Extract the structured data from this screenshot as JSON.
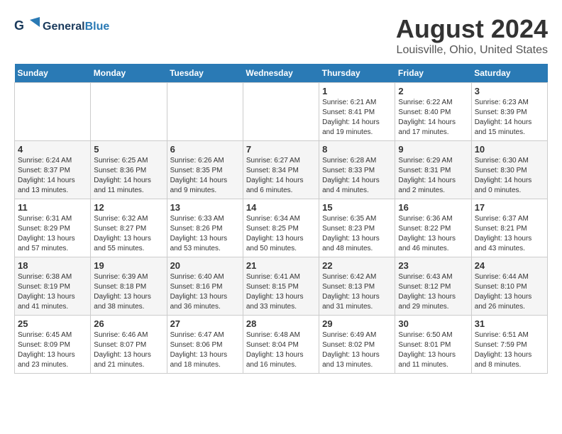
{
  "header": {
    "logo_general": "General",
    "logo_blue": "Blue",
    "month_title": "August 2024",
    "location": "Louisville, Ohio, United States"
  },
  "days_of_week": [
    "Sunday",
    "Monday",
    "Tuesday",
    "Wednesday",
    "Thursday",
    "Friday",
    "Saturday"
  ],
  "weeks": [
    [
      {
        "day": "",
        "info": ""
      },
      {
        "day": "",
        "info": ""
      },
      {
        "day": "",
        "info": ""
      },
      {
        "day": "",
        "info": ""
      },
      {
        "day": "1",
        "info": "Sunrise: 6:21 AM\nSunset: 8:41 PM\nDaylight: 14 hours\nand 19 minutes."
      },
      {
        "day": "2",
        "info": "Sunrise: 6:22 AM\nSunset: 8:40 PM\nDaylight: 14 hours\nand 17 minutes."
      },
      {
        "day": "3",
        "info": "Sunrise: 6:23 AM\nSunset: 8:39 PM\nDaylight: 14 hours\nand 15 minutes."
      }
    ],
    [
      {
        "day": "4",
        "info": "Sunrise: 6:24 AM\nSunset: 8:37 PM\nDaylight: 14 hours\nand 13 minutes."
      },
      {
        "day": "5",
        "info": "Sunrise: 6:25 AM\nSunset: 8:36 PM\nDaylight: 14 hours\nand 11 minutes."
      },
      {
        "day": "6",
        "info": "Sunrise: 6:26 AM\nSunset: 8:35 PM\nDaylight: 14 hours\nand 9 minutes."
      },
      {
        "day": "7",
        "info": "Sunrise: 6:27 AM\nSunset: 8:34 PM\nDaylight: 14 hours\nand 6 minutes."
      },
      {
        "day": "8",
        "info": "Sunrise: 6:28 AM\nSunset: 8:33 PM\nDaylight: 14 hours\nand 4 minutes."
      },
      {
        "day": "9",
        "info": "Sunrise: 6:29 AM\nSunset: 8:31 PM\nDaylight: 14 hours\nand 2 minutes."
      },
      {
        "day": "10",
        "info": "Sunrise: 6:30 AM\nSunset: 8:30 PM\nDaylight: 14 hours\nand 0 minutes."
      }
    ],
    [
      {
        "day": "11",
        "info": "Sunrise: 6:31 AM\nSunset: 8:29 PM\nDaylight: 13 hours\nand 57 minutes."
      },
      {
        "day": "12",
        "info": "Sunrise: 6:32 AM\nSunset: 8:27 PM\nDaylight: 13 hours\nand 55 minutes."
      },
      {
        "day": "13",
        "info": "Sunrise: 6:33 AM\nSunset: 8:26 PM\nDaylight: 13 hours\nand 53 minutes."
      },
      {
        "day": "14",
        "info": "Sunrise: 6:34 AM\nSunset: 8:25 PM\nDaylight: 13 hours\nand 50 minutes."
      },
      {
        "day": "15",
        "info": "Sunrise: 6:35 AM\nSunset: 8:23 PM\nDaylight: 13 hours\nand 48 minutes."
      },
      {
        "day": "16",
        "info": "Sunrise: 6:36 AM\nSunset: 8:22 PM\nDaylight: 13 hours\nand 46 minutes."
      },
      {
        "day": "17",
        "info": "Sunrise: 6:37 AM\nSunset: 8:21 PM\nDaylight: 13 hours\nand 43 minutes."
      }
    ],
    [
      {
        "day": "18",
        "info": "Sunrise: 6:38 AM\nSunset: 8:19 PM\nDaylight: 13 hours\nand 41 minutes."
      },
      {
        "day": "19",
        "info": "Sunrise: 6:39 AM\nSunset: 8:18 PM\nDaylight: 13 hours\nand 38 minutes."
      },
      {
        "day": "20",
        "info": "Sunrise: 6:40 AM\nSunset: 8:16 PM\nDaylight: 13 hours\nand 36 minutes."
      },
      {
        "day": "21",
        "info": "Sunrise: 6:41 AM\nSunset: 8:15 PM\nDaylight: 13 hours\nand 33 minutes."
      },
      {
        "day": "22",
        "info": "Sunrise: 6:42 AM\nSunset: 8:13 PM\nDaylight: 13 hours\nand 31 minutes."
      },
      {
        "day": "23",
        "info": "Sunrise: 6:43 AM\nSunset: 8:12 PM\nDaylight: 13 hours\nand 29 minutes."
      },
      {
        "day": "24",
        "info": "Sunrise: 6:44 AM\nSunset: 8:10 PM\nDaylight: 13 hours\nand 26 minutes."
      }
    ],
    [
      {
        "day": "25",
        "info": "Sunrise: 6:45 AM\nSunset: 8:09 PM\nDaylight: 13 hours\nand 23 minutes."
      },
      {
        "day": "26",
        "info": "Sunrise: 6:46 AM\nSunset: 8:07 PM\nDaylight: 13 hours\nand 21 minutes."
      },
      {
        "day": "27",
        "info": "Sunrise: 6:47 AM\nSunset: 8:06 PM\nDaylight: 13 hours\nand 18 minutes."
      },
      {
        "day": "28",
        "info": "Sunrise: 6:48 AM\nSunset: 8:04 PM\nDaylight: 13 hours\nand 16 minutes."
      },
      {
        "day": "29",
        "info": "Sunrise: 6:49 AM\nSunset: 8:02 PM\nDaylight: 13 hours\nand 13 minutes."
      },
      {
        "day": "30",
        "info": "Sunrise: 6:50 AM\nSunset: 8:01 PM\nDaylight: 13 hours\nand 11 minutes."
      },
      {
        "day": "31",
        "info": "Sunrise: 6:51 AM\nSunset: 7:59 PM\nDaylight: 13 hours\nand 8 minutes."
      }
    ]
  ]
}
